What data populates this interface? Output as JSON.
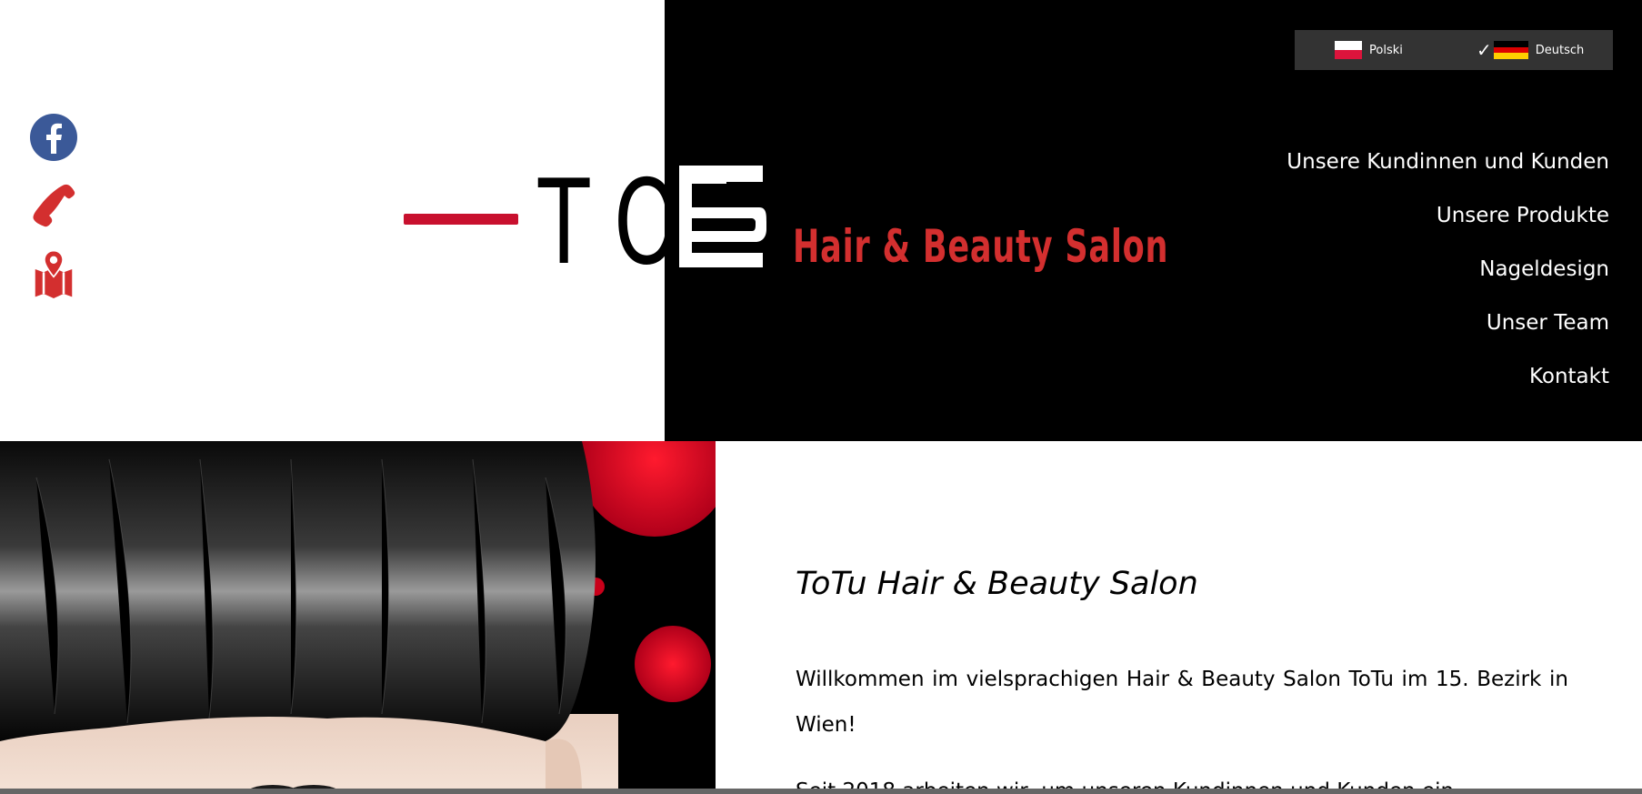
{
  "languages": {
    "polish": "Polski",
    "german": "Deutsch",
    "selected": "Deutsch"
  },
  "logo": {
    "letters_left": "TO",
    "letters_right": "TU",
    "tagline": "Hair & Beauty Salon"
  },
  "social": {
    "facebook_icon": "facebook-icon",
    "phone_icon": "phone-icon",
    "map_icon": "map-pin-icon"
  },
  "nav": {
    "items": [
      "Unsere Kundinnen und Kunden",
      "Unsere Produkte",
      "Nageldesign",
      "Unser Team",
      "Kontakt"
    ]
  },
  "content": {
    "title": "ToTu Hair & Beauty Salon",
    "paragraph1": "Willkommen im vielsprachigen Hair & Beauty Salon ToTu im 15. Bezirk in Wien!",
    "paragraph2_partial": "Seit 2018 arbeiten wir, um unseren Kundinnen und Kunden ein"
  },
  "colors": {
    "brand_red": "#d32f2f",
    "facebook_blue": "#3b5998",
    "header_black": "#000000",
    "lang_bar": "#333333"
  }
}
